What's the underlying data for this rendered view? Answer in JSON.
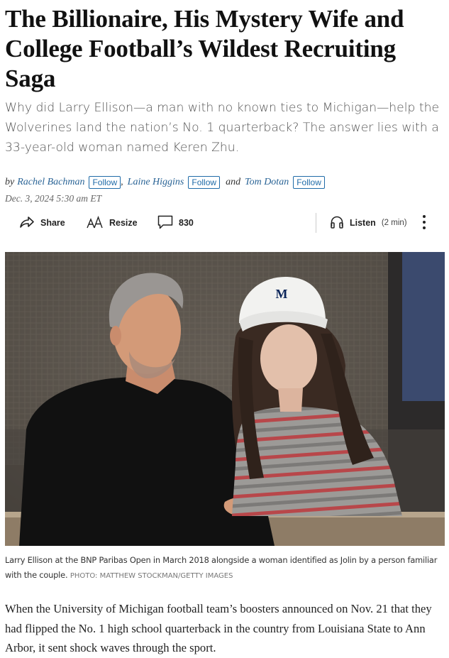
{
  "article": {
    "headline": "The Billionaire, His Mystery Wife and College Football’s Wildest Recruiting Saga",
    "dek": "Why did Larry Ellison—a man with no known ties to Michigan—help the Wolverines land the nation’s No. 1 quarterback? The answer lies with a 33-year-old woman named Keren Zhu.",
    "byline": {
      "prefix": "by",
      "authors": [
        "Rachel Bachman",
        "Laine Higgins",
        "Tom Dotan"
      ],
      "follow_label": "Follow",
      "separator": ",",
      "conjunction": "and"
    },
    "date": "Dec. 3, 2024 5:30 am ET",
    "toolbar": {
      "share_label": "Share",
      "resize_label": "Resize",
      "comments_count": "830",
      "listen_label": "Listen",
      "listen_duration": "(2 min)"
    },
    "photo": {
      "cap_logo": "M"
    },
    "caption": {
      "text": "Larry Ellison at the BNP Paribas Open in March 2018 alongside a woman identified as Jolin by a person familiar with the couple.",
      "credit": "PHOTO: MATTHEW STOCKMAN/GETTY IMAGES"
    },
    "body_paragraph": "When the University of Michigan football team’s boosters announced on Nov. 21 that they had flipped the No. 1 high school quarterback in the country from Louisiana State to Ann Arbor, it sent shock waves through the sport."
  },
  "colors": {
    "link": "#2a6496",
    "follow_border": "#1f6ba8",
    "michigan_navy": "#0b2559"
  },
  "icons": [
    "share-icon",
    "resize-icon",
    "comment-icon",
    "headphones-icon",
    "more-vertical-icon"
  ]
}
